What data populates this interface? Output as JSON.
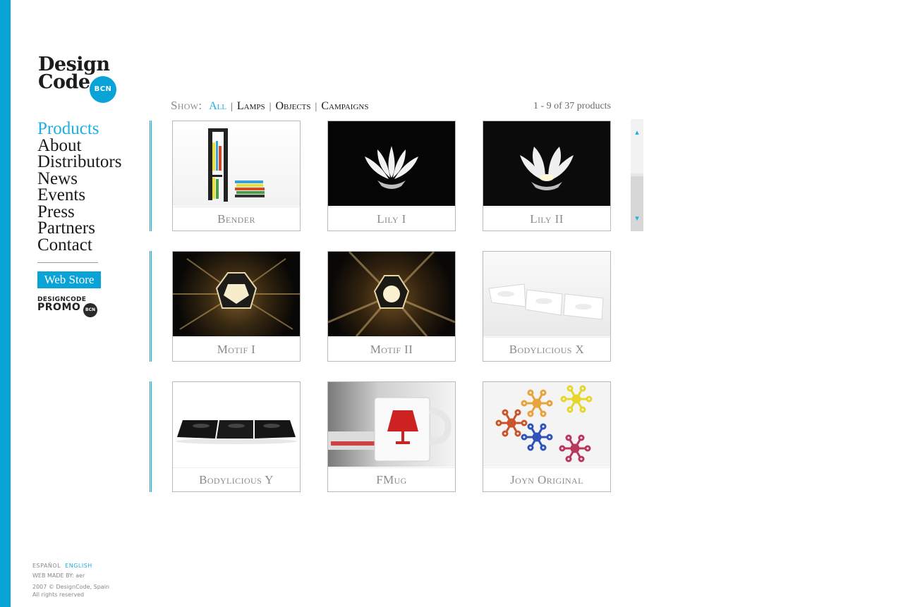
{
  "logo": {
    "word1": "Design",
    "word2": "Code",
    "badge": "BCN"
  },
  "nav": {
    "items": [
      {
        "label": "Products",
        "active": true
      },
      {
        "label": "About"
      },
      {
        "label": "Distributors"
      },
      {
        "label": "News"
      },
      {
        "label": "Events"
      },
      {
        "label": "Press"
      },
      {
        "label": "Partners"
      },
      {
        "label": "Contact"
      }
    ],
    "webstore": "Web Store",
    "promo": {
      "line1": "DESIGNCODE",
      "line2": "PROMO",
      "badge": "BCN"
    }
  },
  "filter": {
    "label": "Show:",
    "options": [
      "All",
      "Lamps",
      "Objects",
      "Campaigns"
    ],
    "active": "All"
  },
  "count": "1 - 9 of 37 products",
  "products": [
    {
      "name": "Bender",
      "image": "bookshelf-photo"
    },
    {
      "name": "Lily I",
      "image": "lamp-photo"
    },
    {
      "name": "Lily II",
      "image": "lamp-photo"
    },
    {
      "name": "Motif I",
      "image": "lamp-photo"
    },
    {
      "name": "Motif II",
      "image": "lamp-photo"
    },
    {
      "name": "Bodylicious X",
      "image": "tray-photo"
    },
    {
      "name": "Bodylicious Y",
      "image": "tray-photo"
    },
    {
      "name": "FMug",
      "image": "mug-photo"
    },
    {
      "name": "Joyn Original",
      "image": "connector-photo"
    }
  ],
  "footer": {
    "lang_es": "ESPAÑOL",
    "lang_en": "ENGLISH",
    "made_by": "WEB MADE BY: aer",
    "copyright": "2007 © DesignCode, Spain",
    "rights": "All rights reserved"
  },
  "colors": {
    "accent": "#0aa3d8",
    "title_gray": "#8a8a8a"
  }
}
